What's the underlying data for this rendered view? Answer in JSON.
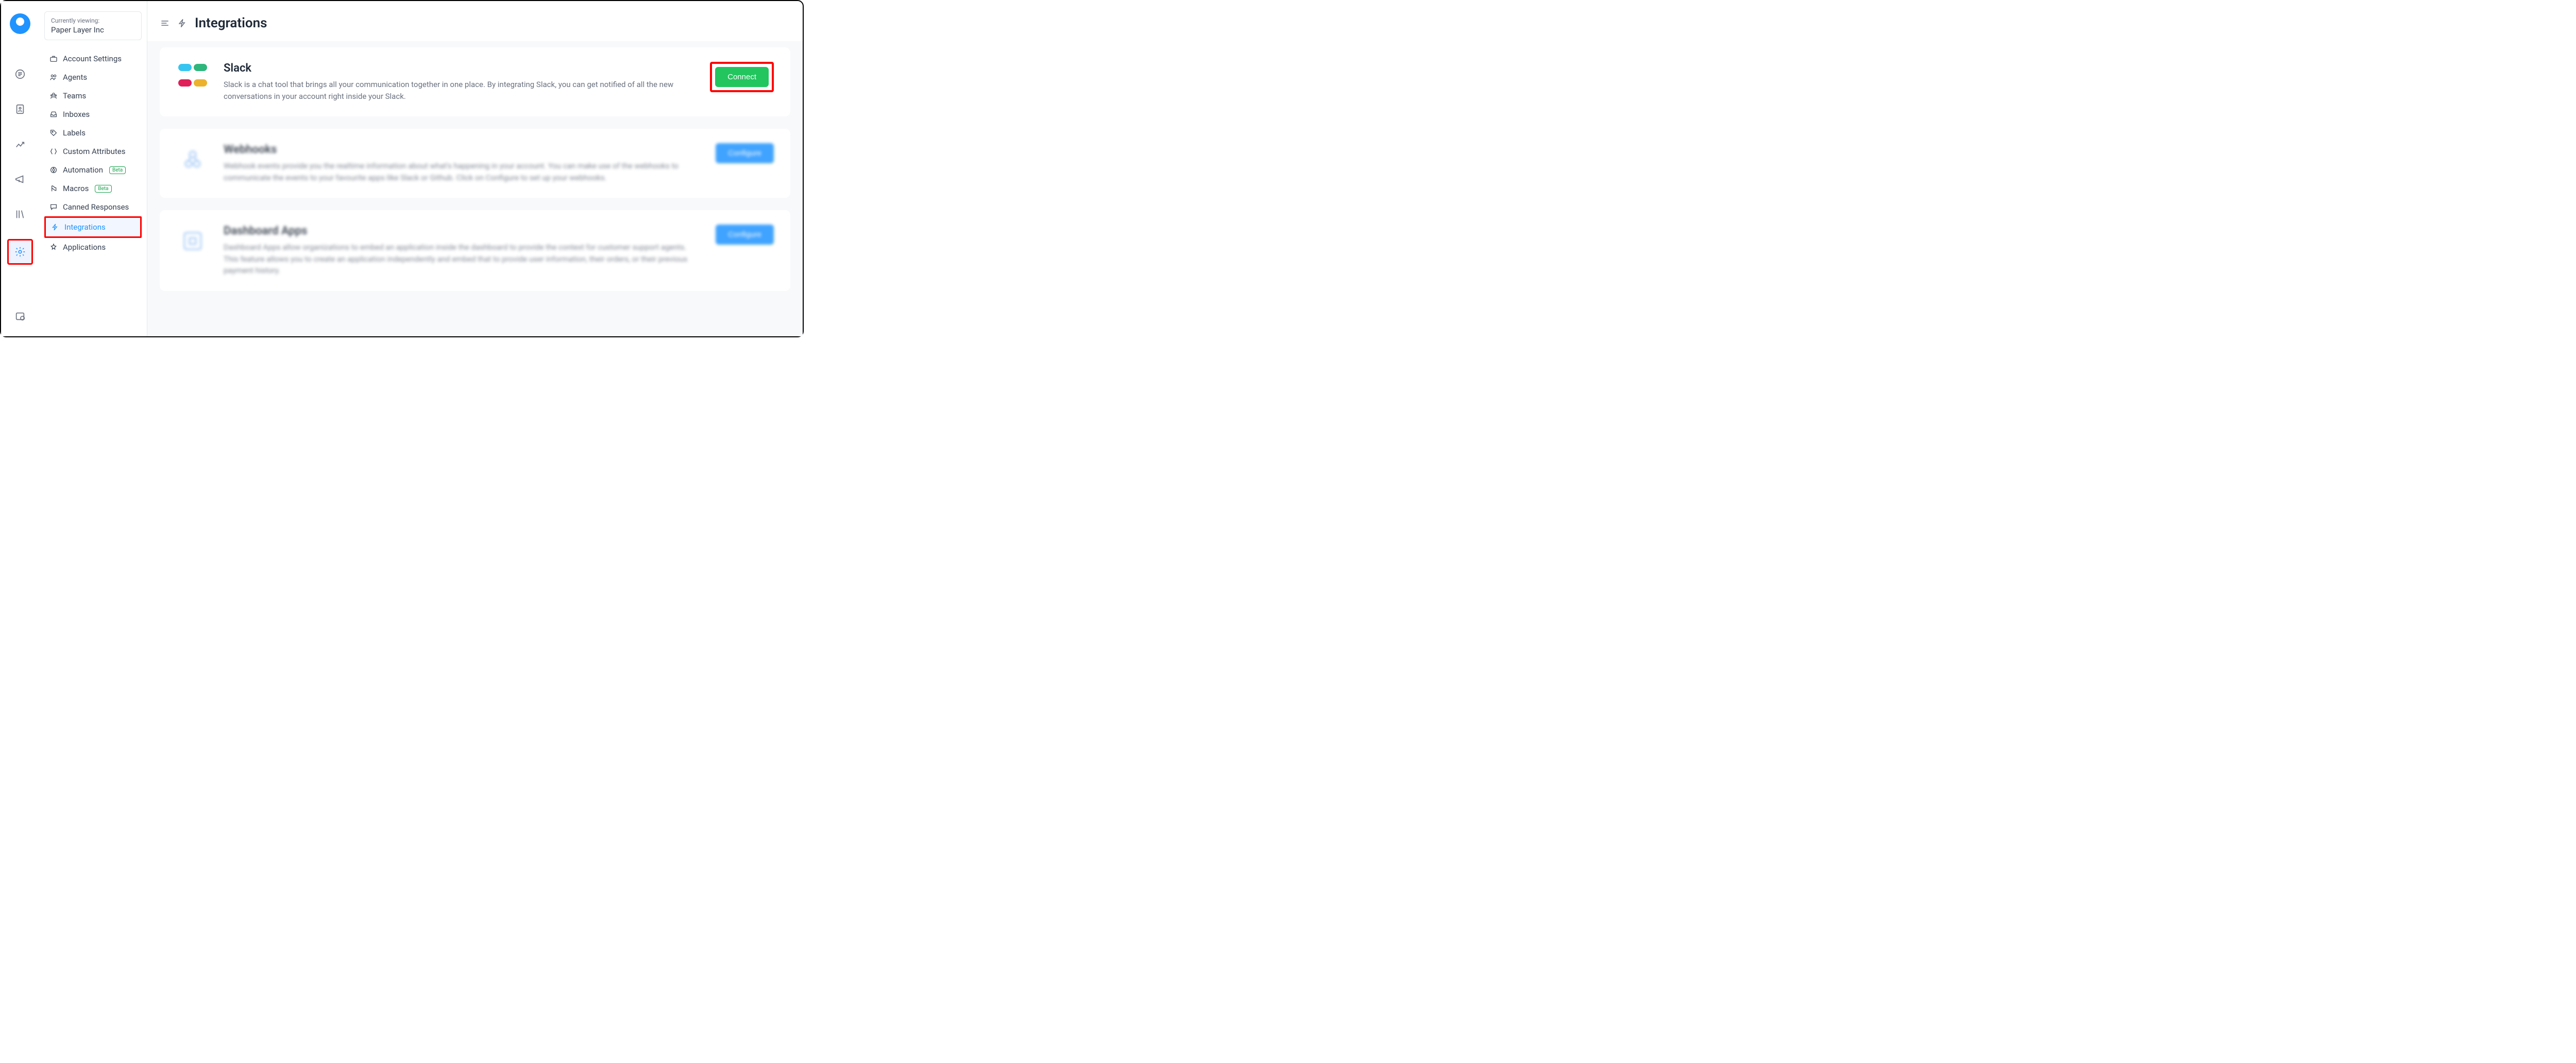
{
  "rail": {
    "items": [
      {
        "name": "conversations-icon"
      },
      {
        "name": "contacts-icon"
      },
      {
        "name": "reports-icon"
      },
      {
        "name": "campaigns-icon"
      },
      {
        "name": "library-icon"
      },
      {
        "name": "settings-icon",
        "active": true,
        "highlighted": true
      }
    ],
    "bottom": {
      "name": "docs-icon"
    }
  },
  "org": {
    "label": "Currently viewing:",
    "name": "Paper Layer Inc"
  },
  "sidebar": {
    "items": [
      {
        "icon": "briefcase-icon",
        "label": "Account Settings"
      },
      {
        "icon": "agents-icon",
        "label": "Agents"
      },
      {
        "icon": "teams-icon",
        "label": "Teams"
      },
      {
        "icon": "inboxes-icon",
        "label": "Inboxes"
      },
      {
        "icon": "labels-icon",
        "label": "Labels"
      },
      {
        "icon": "custom-attributes-icon",
        "label": "Custom Attributes"
      },
      {
        "icon": "automation-icon",
        "label": "Automation",
        "badge": "Beta"
      },
      {
        "icon": "macros-icon",
        "label": "Macros",
        "badge": "Beta"
      },
      {
        "icon": "canned-responses-icon",
        "label": "Canned Responses"
      },
      {
        "icon": "integrations-icon",
        "label": "Integrations",
        "active": true,
        "highlighted": true
      },
      {
        "icon": "applications-icon",
        "label": "Applications"
      }
    ]
  },
  "header": {
    "title": "Integrations"
  },
  "integrations": [
    {
      "icon": "slack-logo",
      "title": "Slack",
      "description": "Slack is a chat tool that brings all your communication together in one place. By integrating Slack, you can get notified of all the new conversations in your account right inside your Slack.",
      "action": "Connect",
      "action_style": "green",
      "highlighted": true,
      "blurred": false
    },
    {
      "icon": "webhooks-icon",
      "title": "Webhooks",
      "description": "Webhook events provide you the realtime information about what's happening in your account. You can make use of the webhooks to communicate the events to your favourite apps like Slack or Github. Click on Configure to set up your webhooks.",
      "action": "Configure",
      "action_style": "blue",
      "highlighted": false,
      "blurred": true
    },
    {
      "icon": "dashboard-apps-icon",
      "title": "Dashboard Apps",
      "description": "Dashboard Apps allow organizations to embed an application inside the dashboard to provide the context for customer support agents. This feature allows you to create an application independently and embed that to provide user information, their orders, or their previous payment history.",
      "action": "Configure",
      "action_style": "blue",
      "highlighted": false,
      "blurred": true
    }
  ],
  "badges": {
    "beta": "Beta"
  }
}
